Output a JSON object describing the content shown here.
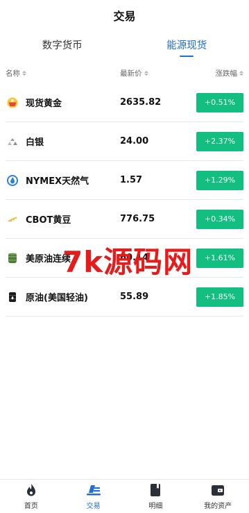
{
  "header": {
    "title": "交易"
  },
  "tabs": [
    {
      "label": "数字货币",
      "active": false
    },
    {
      "label": "能源现货",
      "active": true
    }
  ],
  "table": {
    "columns": {
      "name": "名称",
      "price": "最新价",
      "change": "涨跌幅"
    },
    "rows": [
      {
        "name": "现货黄金",
        "price": "2635.82",
        "change": "+0.51%",
        "icon": "gold-icon"
      },
      {
        "name": "白银",
        "price": "24.00",
        "change": "+2.37%",
        "icon": "silver-icon"
      },
      {
        "name": "NYMEX天然气",
        "price": "1.57",
        "change": "+1.29%",
        "icon": "natural-gas-flame-icon"
      },
      {
        "name": "CBOT黄豆",
        "price": "776.75",
        "change": "+0.34%",
        "icon": "soybean-icon"
      },
      {
        "name": "美原油连续",
        "price": "60.14",
        "change": "+1.61%",
        "icon": "oil-barrel-icon"
      },
      {
        "name": "原油(美国轻油)",
        "price": "55.89",
        "change": "+1.85%",
        "icon": "oil-drum-icon"
      }
    ]
  },
  "watermark": "7k源码网",
  "tabbar": [
    {
      "label": "首页",
      "icon": "flame-home-icon",
      "active": false
    },
    {
      "label": "交易",
      "icon": "trade-icon",
      "active": true
    },
    {
      "label": "明细",
      "icon": "ledger-icon",
      "active": false
    },
    {
      "label": "我的资产",
      "icon": "wallet-icon",
      "active": false
    }
  ],
  "colors": {
    "accent": "#1f6fd6",
    "up": "#12bf80",
    "watermark": "#e51c1c"
  }
}
